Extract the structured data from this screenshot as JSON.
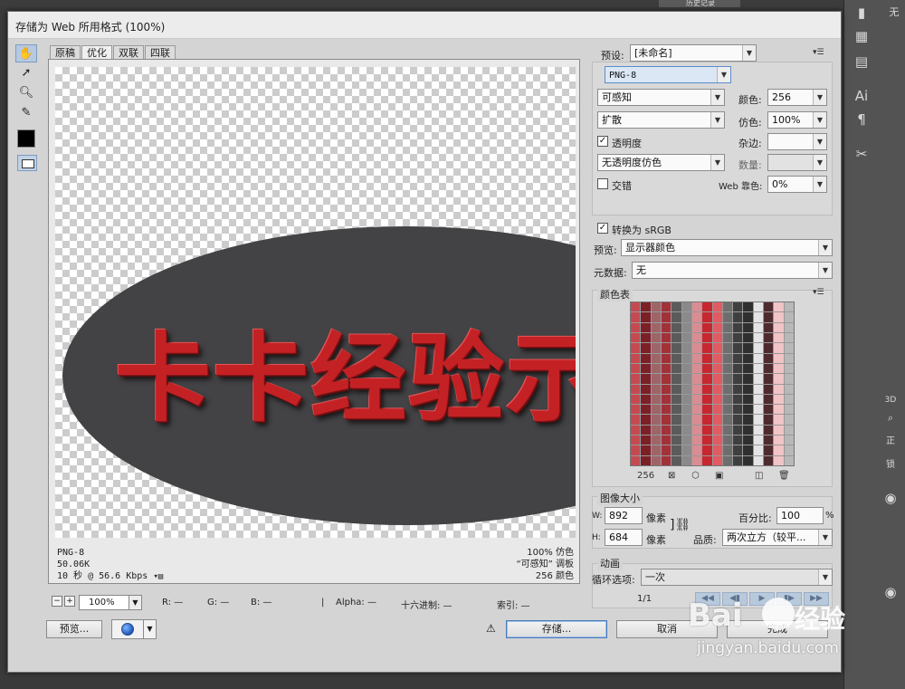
{
  "window": {
    "title": "存储为 Web 所用格式 (100%)",
    "history_tab": "历史记录",
    "right_edge_label": "无"
  },
  "bg_panel": {
    "labels": [
      "3D",
      "正",
      "锁",
      "Ai",
      "¶"
    ]
  },
  "tools": [
    "hand-tool",
    "slice-select-tool",
    "zoom-tool",
    "eyedropper-tool"
  ],
  "tabs": [
    {
      "label": "原稿",
      "active": false
    },
    {
      "label": "优化",
      "active": true
    },
    {
      "label": "双联",
      "active": false
    },
    {
      "label": "四联",
      "active": false
    }
  ],
  "preview": {
    "image_text": "卡卡经验示",
    "info_left": [
      "PNG-8",
      "50.06K",
      "10 秒 @ 56.6 Kbps"
    ],
    "info_right": [
      "100% 仿色",
      "“可感知” 调板",
      "256 颜色"
    ]
  },
  "zoom": {
    "value": "100%",
    "r": "R: —",
    "g": "G: —",
    "b": "B: —",
    "alpha": "Alpha: —",
    "hex": "十六进制: —",
    "index": "索引: —"
  },
  "buttons": {
    "preview": "预览...",
    "save": "存储...",
    "cancel": "取消",
    "done": "完成"
  },
  "settings": {
    "preset_label": "预设:",
    "preset_value": "[未命名]",
    "format": "PNG-8",
    "reduction": "可感知",
    "colors_label": "颜色:",
    "colors_value": "256",
    "dither_algo": "扩散",
    "dither_label": "仿色:",
    "dither_value": "100%",
    "transparency_label": "透明度",
    "matte_label": "杂边:",
    "trans_dither": "无透明度仿色",
    "amount_label": "数量:",
    "interlaced_label": "交错",
    "web_snap_label": "Web 靠色:",
    "web_snap_value": "0%",
    "srgb_label": "转换为 sRGB",
    "preview_label": "预览:",
    "preview_value": "显示器颜色",
    "metadata_label": "元数据:",
    "metadata_value": "无"
  },
  "color_table": {
    "title": "颜色表",
    "count": "256"
  },
  "image_size": {
    "title": "图像大小",
    "w_label": "W:",
    "w_value": "892",
    "w_unit": "像素",
    "h_label": "H:",
    "h_value": "684",
    "h_unit": "像素",
    "percent_label": "百分比:",
    "percent_value": "100",
    "percent_unit": "%",
    "quality_label": "品质:",
    "quality_value": "两次立方（较平..."
  },
  "animation": {
    "title": "动画",
    "loop_label": "循环选项:",
    "loop_value": "一次",
    "frame": "1/1"
  },
  "watermark": {
    "brand": "Bai",
    "brand2": "经验",
    "url": "jingyan.baidu.com"
  }
}
